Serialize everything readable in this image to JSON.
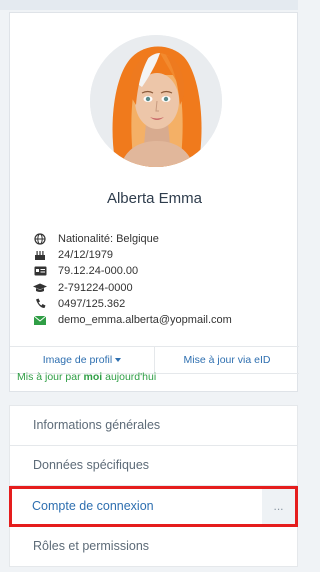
{
  "profile": {
    "name": "Alberta Emma",
    "info": [
      {
        "icon": "globe-icon",
        "text": "Nationalité: Belgique"
      },
      {
        "icon": "birthday-cake-icon",
        "text": "24/12/1979"
      },
      {
        "icon": "id-card-icon",
        "text": "79.12.24-000.00"
      },
      {
        "icon": "graduation-cap-icon",
        "text": "2-791224-0000"
      },
      {
        "icon": "phone-icon",
        "text": "0497/125.362"
      },
      {
        "icon": "envelope-icon",
        "text": "demo_emma.alberta@yopmail.com"
      }
    ],
    "actions": {
      "profile_image": "Image de profil",
      "update_eid": "Mise à jour via eID"
    },
    "updated": {
      "prefix": "Mis à jour par ",
      "by": "moi",
      "suffix": " aujourd'hui"
    }
  },
  "menu": {
    "items": [
      {
        "label": "Informations générales"
      },
      {
        "label": "Données spécifiques"
      },
      {
        "label": "Compte de connexion",
        "more": "..."
      },
      {
        "label": "Rôles et permissions"
      }
    ]
  },
  "colors": {
    "accent": "#2e6fb0",
    "success": "#2f9e45",
    "highlight": "#e51d1d",
    "envelope": "#2f9e45"
  }
}
